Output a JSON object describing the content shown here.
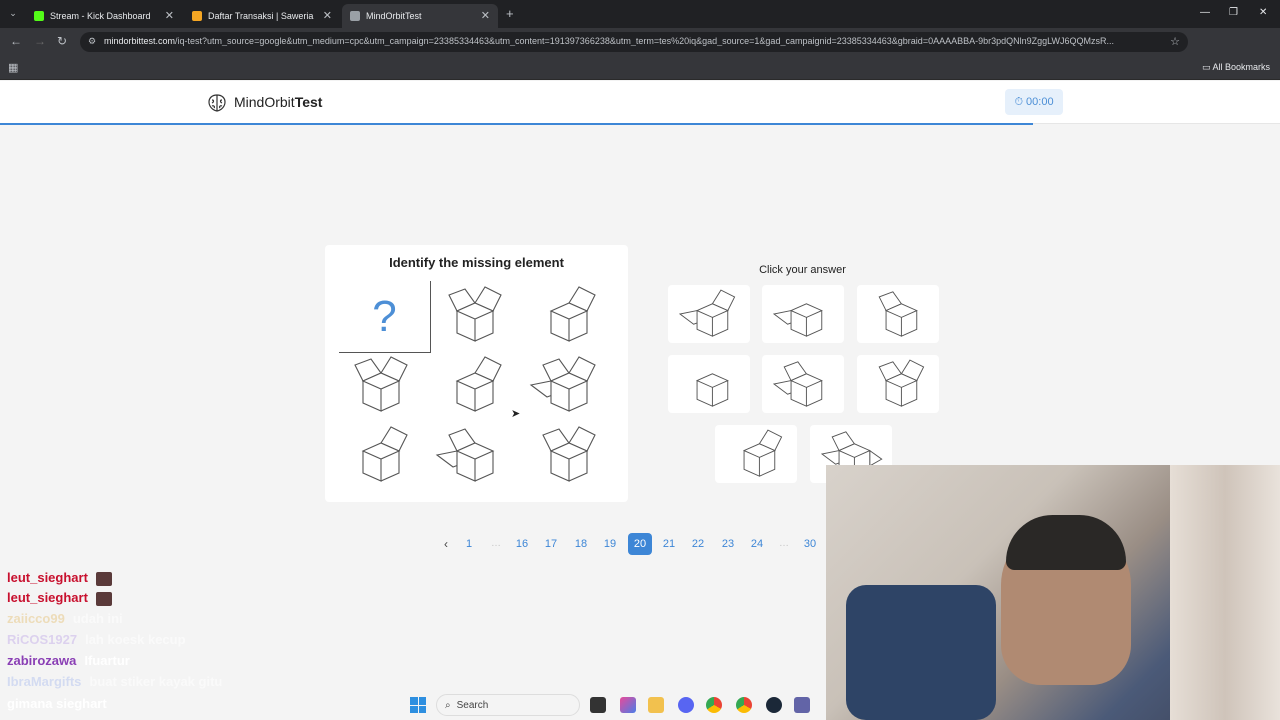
{
  "browser": {
    "tabs": [
      {
        "title": "Stream - Kick Dashboard",
        "color": "#53fc18"
      },
      {
        "title": "Daftar Transaksi | Saweria",
        "color": "#f5a623"
      },
      {
        "title": "MindOrbitTest",
        "color": "#9aa0a6"
      }
    ],
    "url_host": "mindorbittest.com",
    "url_rest": "/iq-test?utm_source=google&utm_medium=cpc&utm_campaign=23385334463&utm_content=191397366238&utm_term=tes%20iq&gad_source=1&gad_campaignid=23385334463&gbraid=0AAAABBA-9br3pdQNln9ZggLWJ6QQMzsR...",
    "all_bookmarks": "All Bookmarks"
  },
  "site": {
    "brand_light": "MindOrbit",
    "brand_bold": "Test",
    "timer": "00:00",
    "accent": "#3d86d6",
    "progress_fraction": 0.807
  },
  "question": {
    "title": "Identify the missing element",
    "missing_mark": "?",
    "answer_header": "Click your answer"
  },
  "pagination": {
    "prev": "‹",
    "pages": [
      "1",
      "…",
      "16",
      "17",
      "18",
      "19",
      "20",
      "21",
      "22",
      "23",
      "24",
      "…",
      "30"
    ],
    "current": "20"
  },
  "chat": [
    {
      "user": "leut_sieghart",
      "msg": "",
      "color": "#c8102e"
    },
    {
      "user": "leut_sieghart",
      "msg": "",
      "color": "#c8102e"
    },
    {
      "user": "zaiicco99",
      "msg": "udah ini",
      "color": "#e8c98a"
    },
    {
      "user": "RiCOS1927",
      "msg": "lah koesk kecup",
      "color": "#c9b6ea"
    },
    {
      "user": "zabirozawa",
      "msg": "Ifuartur",
      "color": "#8a3fb5"
    },
    {
      "user": "IbraMargifts",
      "msg": "buat stiker kayak gitu",
      "color": "#b9c7f0"
    },
    {
      "user": "gimana sieghart",
      "msg": "",
      "color": "#ffffff"
    }
  ],
  "taskbar": {
    "search": "Search"
  }
}
